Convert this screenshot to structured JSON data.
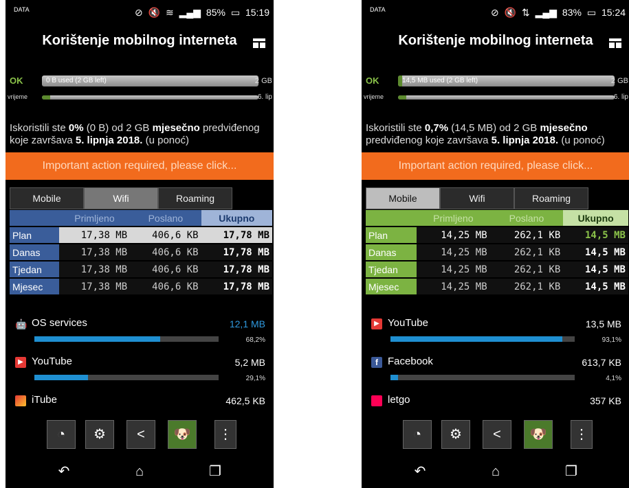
{
  "left": {
    "status": {
      "left_icon": "DATA",
      "battery": "85%",
      "time": "15:19"
    },
    "title": "Korištenje mobilnog interneta",
    "ok_label": "OK",
    "data_bar": {
      "label": "0 B used (2 GB left)",
      "right": "2 GB",
      "fill": 0
    },
    "time_bar": {
      "label": "vrijeme",
      "right": "6. lip",
      "fill": 0.03
    },
    "info_parts": [
      "Iskoristili ste ",
      "0%",
      " (0 B) od 2 GB ",
      "mjesečno",
      " predviđenog koje završava ",
      "5. lipnja 2018.",
      " (u ponoć)"
    ],
    "banner": "Important action required, please click...",
    "tabs": [
      "Mobile",
      "Wifi",
      "Roaming"
    ],
    "table": {
      "headers": [
        "",
        "Primljeno",
        "Poslano",
        "Ukupno"
      ],
      "rows": [
        [
          "Plan",
          "17,38 MB",
          "406,6 KB",
          "17,78 MB"
        ],
        [
          "Danas",
          "17,38 MB",
          "406,6 KB",
          "17,78 MB"
        ],
        [
          "Tjedan",
          "17,38 MB",
          "406,6 KB",
          "17,78 MB"
        ],
        [
          "Mjesec",
          "17,38 MB",
          "406,6 KB",
          "17,78 MB"
        ]
      ]
    },
    "apps": [
      {
        "name": "OS services",
        "size": "12,1 MB",
        "pct": "68,2%",
        "fill": 0.682,
        "icon": "android-icon"
      },
      {
        "name": "YouTube",
        "size": "5,2 MB",
        "pct": "29,1%",
        "fill": 0.291,
        "icon": "youtube-icon"
      },
      {
        "name": "iTube",
        "size": "462,5 KB",
        "pct": "",
        "fill": 0,
        "icon": "itube-icon"
      }
    ]
  },
  "right": {
    "status": {
      "left_icon": "DATA",
      "battery": "83%",
      "time": "15:24"
    },
    "title": "Korištenje mobilnog interneta",
    "ok_label": "OK",
    "data_bar": {
      "label": "14,5 MB used (2 GB left)",
      "right": "2 GB",
      "fill": 0.007
    },
    "time_bar": {
      "label": "vrijeme",
      "right": "6. lip",
      "fill": 0.03
    },
    "info_parts": [
      "Iskoristili ste ",
      "0,7%",
      " (14,5 MB) od 2 GB ",
      "mjesečno",
      " predviđenog koje završava ",
      "5. lipnja 2018.",
      " (u ponoć)"
    ],
    "banner": "Important action required, please click...",
    "tabs": [
      "Mobile",
      "Wifi",
      "Roaming"
    ],
    "table": {
      "headers": [
        "",
        "Primljeno",
        "Poslano",
        "Ukupno"
      ],
      "rows": [
        [
          "Plan",
          "14,25 MB",
          "262,1 KB",
          "14,5 MB"
        ],
        [
          "Danas",
          "14,25 MB",
          "262,1 KB",
          "14,5 MB"
        ],
        [
          "Tjedan",
          "14,25 MB",
          "262,1 KB",
          "14,5 MB"
        ],
        [
          "Mjesec",
          "14,25 MB",
          "262,1 KB",
          "14,5 MB"
        ]
      ]
    },
    "apps": [
      {
        "name": "YouTube",
        "size": "13,5 MB",
        "pct": "93,1%",
        "fill": 0.931,
        "icon": "youtube-icon"
      },
      {
        "name": "Facebook",
        "size": "613,7 KB",
        "pct": "4,1%",
        "fill": 0.041,
        "icon": "facebook-icon"
      },
      {
        "name": "letgo",
        "size": "357 KB",
        "pct": "",
        "fill": 0,
        "icon": "letgo-icon"
      }
    ]
  },
  "colors": {
    "accent_left": "#3a5d9a",
    "accent_right": "#7cb342",
    "banner": "#f26b1d",
    "bar": "#1f8fd1"
  }
}
